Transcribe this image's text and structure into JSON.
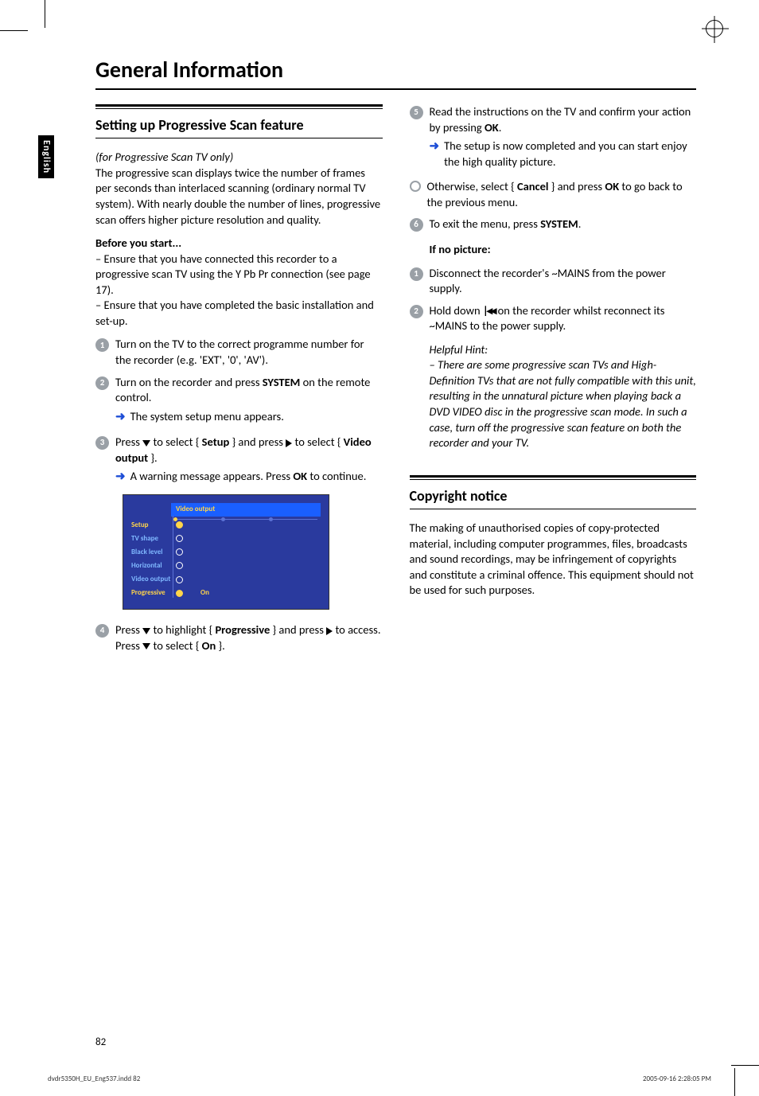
{
  "side_tab": "English",
  "page_title": "General Information",
  "left": {
    "section_heading": "Setting up Progressive Scan feature",
    "intro_italic": "(for Progressive Scan TV only)",
    "intro_body": "The progressive scan displays twice the number of frames per seconds than interlaced scanning (ordinary normal TV system). With nearly double the number of lines, progressive scan offers higher picture resolution and quality.",
    "before_heading": "Before you start...",
    "before_l1": "–  Ensure that you have connected this recorder to a progressive scan TV using the Y Pb Pr connection (see page 17).",
    "before_l2": "–  Ensure that you have completed the basic installation and set-up.",
    "step1": "Turn on the TV to the correct programme number for the recorder (e.g. 'EXT', '0', 'AV').",
    "step2a": "Turn on the recorder and press ",
    "step2b": "SYSTEM",
    "step2c": " on the remote control.",
    "step2_sub": "The system setup menu appears.",
    "step3a": "Press ",
    "step3b": " to select { ",
    "step3c": "Setup",
    "step3d": " } and press ",
    "step3e": " to select { ",
    "step3f": "Video output",
    "step3g": " }.",
    "step3_suba": "A warning message appears.  Press ",
    "step3_subb": "OK",
    "step3_subc": " to continue.",
    "step4a": "Press ",
    "step4b": " to highlight { ",
    "step4c": "Progressive",
    "step4d": " } and press ",
    "step4e": " to access.  Press ",
    "step4f": " to select { ",
    "step4g": "On",
    "step4h": " }."
  },
  "osd": {
    "top": "Video output",
    "rows": [
      {
        "label": "Setup",
        "active": true
      },
      {
        "label": "TV shape"
      },
      {
        "label": "Black level"
      },
      {
        "label": "Horizontal"
      },
      {
        "label": "Video output"
      },
      {
        "label": "Progressive",
        "value": "On",
        "selected": true
      }
    ]
  },
  "right": {
    "step5a": "Read the instructions on the TV and confirm your action by pressing ",
    "step5b": "OK",
    "step5c": ".",
    "step5_sub": "The setup is now completed and you can start enjoy the high quality picture.",
    "bullet_a": "Otherwise, select { ",
    "bullet_b": "Cancel",
    "bullet_c": " } and press ",
    "bullet_d": "OK",
    "bullet_e": " to go back to the previous menu.",
    "step6a": "To exit the menu, press ",
    "step6b": "SYSTEM",
    "step6c": ".",
    "if_no_picture": "If no picture:",
    "r_step1": "Disconnect the recorder's ~MAINS from the power supply.",
    "r_step2a": "Hold down ",
    "r_step2b": " on the recorder whilst reconnect its ~MAINS to the power supply.",
    "hint_head": "Helpful Hint:",
    "hint_body": "– There are some progressive scan TVs and High-Definition TVs that are not fully compatible with this unit, resulting in the unnatural picture when playing back a DVD VIDEO disc in the progressive scan mode. In such a case, turn off the progressive scan feature on both the recorder and your TV.",
    "section2_heading": "Copyright notice",
    "section2_body": "The making of unauthorised copies of copy-protected material, including computer programmes, files, broadcasts and sound recordings, may be infringement of copyrights and constitute a criminal offence.  This equipment should not be used for such purposes."
  },
  "page_num": "82",
  "footer_left": "dvdr5350H_EU_Eng537.indd   82",
  "footer_right": "2005-09-16   2:28:05 PM"
}
